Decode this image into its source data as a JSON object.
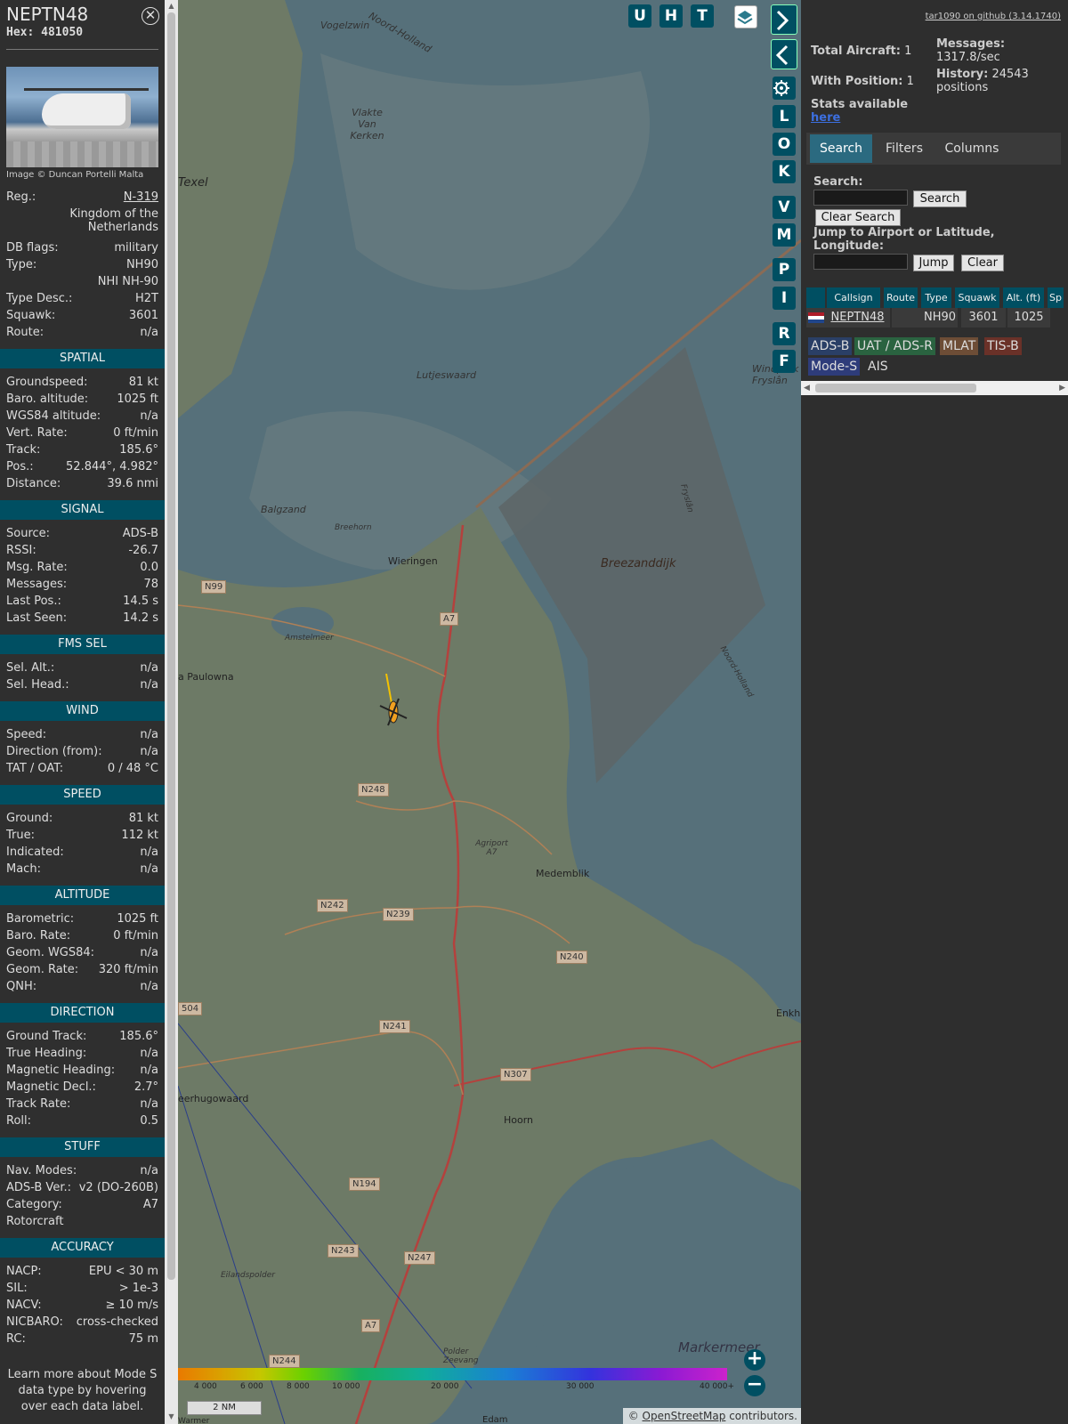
{
  "info": {
    "callsign": "NEPTN48",
    "hex_label": "Hex:",
    "hex": "481050",
    "close_symbol": "✕",
    "image_credit": "Image © Duncan Portelli Malta",
    "general": [
      {
        "k": "Reg.:",
        "v": "N-319"
      },
      {
        "k": "",
        "v": "Kingdom of the Netherlands"
      },
      {
        "k": "DB flags:",
        "v": "military"
      },
      {
        "k": "Type:",
        "v": "NH90"
      },
      {
        "k": "",
        "v": "NHI NH-90"
      },
      {
        "k": "Type Desc.:",
        "v": "H2T"
      },
      {
        "k": "Squawk:",
        "v": "3601"
      },
      {
        "k": "Route:",
        "v": "n/a"
      }
    ],
    "sections": [
      {
        "title": "SPATIAL",
        "rows": [
          {
            "k": "Groundspeed:",
            "v": "81 kt"
          },
          {
            "k": "Baro. altitude:",
            "v": "1025 ft"
          },
          {
            "k": "WGS84 altitude:",
            "v": "n/a"
          },
          {
            "k": "Vert. Rate:",
            "v": "0 ft/min"
          },
          {
            "k": "Track:",
            "v": "185.6°"
          },
          {
            "k": "Pos.:",
            "v": "52.844°, 4.982°"
          },
          {
            "k": "Distance:",
            "v": "39.6 nmi"
          }
        ]
      },
      {
        "title": "SIGNAL",
        "rows": [
          {
            "k": "Source:",
            "v": "ADS-B"
          },
          {
            "k": "RSSI:",
            "v": "-26.7"
          },
          {
            "k": "Msg. Rate:",
            "v": "0.0"
          },
          {
            "k": "Messages:",
            "v": "78"
          },
          {
            "k": "Last Pos.:",
            "v": "14.5 s"
          },
          {
            "k": "Last Seen:",
            "v": "14.2 s"
          }
        ]
      },
      {
        "title": "FMS SEL",
        "rows": [
          {
            "k": "Sel. Alt.:",
            "v": "n/a"
          },
          {
            "k": "Sel. Head.:",
            "v": "n/a"
          }
        ]
      },
      {
        "title": "WIND",
        "rows": [
          {
            "k": "Speed:",
            "v": "n/a"
          },
          {
            "k": "Direction (from):",
            "v": "n/a"
          },
          {
            "k": "TAT / OAT:",
            "v": "0 / 48 °C"
          }
        ]
      },
      {
        "title": "SPEED",
        "rows": [
          {
            "k": "Ground:",
            "v": "81 kt"
          },
          {
            "k": "True:",
            "v": "112 kt"
          },
          {
            "k": "Indicated:",
            "v": "n/a"
          },
          {
            "k": "Mach:",
            "v": "n/a"
          }
        ]
      },
      {
        "title": "ALTITUDE",
        "rows": [
          {
            "k": "Barometric:",
            "v": "1025 ft"
          },
          {
            "k": "Baro. Rate:",
            "v": "0 ft/min"
          },
          {
            "k": "Geom. WGS84:",
            "v": "n/a"
          },
          {
            "k": "Geom. Rate:",
            "v": "320 ft/min"
          },
          {
            "k": "QNH:",
            "v": "n/a"
          }
        ]
      },
      {
        "title": "DIRECTION",
        "rows": [
          {
            "k": "Ground Track:",
            "v": "185.6°"
          },
          {
            "k": "True Heading:",
            "v": "n/a"
          },
          {
            "k": "Magnetic Heading:",
            "v": "n/a"
          },
          {
            "k": "Magnetic Decl.:",
            "v": "2.7°"
          },
          {
            "k": "Track Rate:",
            "v": "n/a"
          },
          {
            "k": "Roll:",
            "v": "0.5"
          }
        ]
      },
      {
        "title": "STUFF",
        "rows": [
          {
            "k": "Nav. Modes:",
            "v": "n/a"
          },
          {
            "k": "ADS-B Ver.:",
            "v": "v2 (DO-260B)"
          },
          {
            "k": "Category:",
            "v": "A7"
          },
          {
            "k": "Rotorcraft",
            "v": ""
          }
        ]
      },
      {
        "title": "ACCURACY",
        "rows": [
          {
            "k": "NACP:",
            "v": "EPU < 30 m"
          },
          {
            "k": "SIL:",
            "v": "> 1e-3"
          },
          {
            "k": "NACV:",
            "v": "≥ 10 m/s"
          },
          {
            "k": "NICBARO:",
            "v": "cross-checked"
          },
          {
            "k": "RC:",
            "v": "75 m"
          }
        ]
      }
    ],
    "learn_more": "Learn more about Mode S data type by hovering over each data label."
  },
  "map": {
    "buttons_top": [
      "U",
      "H",
      "T"
    ],
    "buttons_side": [
      "L",
      "O",
      "K",
      "V",
      "M",
      "P",
      "I",
      "R",
      "F"
    ],
    "labels": {
      "texel": "Texel",
      "vogelzwin": "Vogelzwin",
      "noord_holland_top": "Noord-Holland",
      "vlakte": "Vlakte Van Kerken",
      "lutjeswaard": "Lutjeswaard",
      "balgzand": "Balgzand",
      "breehorn": "Breehorn",
      "wieringen": "Wieringen",
      "amstelmeer": "Amstelmeer",
      "anna_paulowna": "a Paulowna",
      "breezanddijk": "Breezanddijk",
      "windpark": "Windpark Fryslân",
      "fryslan": "Fryslân",
      "noord_holland_e": "Noord-Holland",
      "agriport": "Agriport A7",
      "medemblik": "Medemblik",
      "enkhuizen": "Enkhu",
      "heerhugowaard": "eerhugowaard",
      "hoorn": "Hoorn",
      "eilandspolder": "Eilandspolder",
      "markermeer": "Markermeer",
      "polder_zeevang": "Polder Zeevang",
      "edam": "Edam",
      "warmen": "Warmer"
    },
    "roads": [
      "N99",
      "A7",
      "N248",
      "N242",
      "N239",
      "N240",
      "N241",
      "N307",
      "N194",
      "N243",
      "N247",
      "A7",
      "N244",
      "504"
    ],
    "colorbar_ticks": [
      "4 000",
      "6 000",
      "8 000",
      "10 000",
      "20 000",
      "30 000",
      "40 000+"
    ],
    "scale": "2 NM",
    "attribution_prefix": "© ",
    "attribution_link": "OpenStreetMap",
    "attribution_suffix": " contributors."
  },
  "panel": {
    "github": "tar1090 on github (3.14.1740)",
    "total_aircraft_label": "Total Aircraft:",
    "total_aircraft": "1",
    "with_position_label": "With Position:",
    "with_position": "1",
    "stats_label": "Stats available",
    "stats_link": "here",
    "messages_label": "Messages:",
    "messages_value": "1317.8/sec",
    "history_label": "History:",
    "history_value": "24543 positions",
    "tabs": [
      "Search",
      "Filters",
      "Columns"
    ],
    "search_label": "Search:",
    "search_button": "Search",
    "clear_search_button": "Clear Search",
    "jump_label": "Jump to Airport or Latitude, Longitude:",
    "jump_button": "Jump",
    "clear_button": "Clear",
    "table_headers": [
      "Callsign",
      "Route",
      "Type",
      "Squawk",
      "Alt. (ft)",
      "Sp"
    ],
    "table_row": {
      "callsign": "NEPTN48",
      "route": "",
      "type": "NH90",
      "squawk": "3601",
      "alt": "1025"
    },
    "source_chips": [
      "ADS-B",
      "UAT / ADS-R",
      "MLAT",
      "TIS-B",
      "Mode-S",
      "AIS"
    ],
    "colors": {
      "accent": "#004f62",
      "adsb": "#2a3f66",
      "uat": "#2a6340",
      "mlat": "#6d4d36",
      "tisb": "#6a3128",
      "modes": "#2e3c7a"
    }
  }
}
